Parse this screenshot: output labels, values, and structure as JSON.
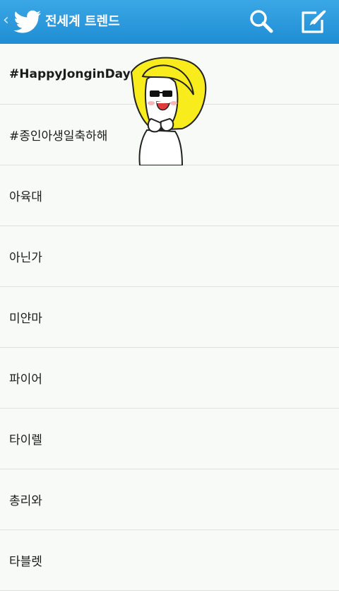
{
  "header": {
    "title": "전세계 트렌드",
    "back_icon": "chevron-left-icon",
    "logo_icon": "twitter-bird-icon",
    "search_icon": "search-icon",
    "compose_icon": "compose-icon",
    "accent_color": "#2b9ae0"
  },
  "trends": [
    {
      "label": "#HappyJonginDay"
    },
    {
      "label": "#종인아생일축하해"
    },
    {
      "label": "아육대"
    },
    {
      "label": "아닌가"
    },
    {
      "label": "미얀마"
    },
    {
      "label": "파이어"
    },
    {
      "label": "타이렐"
    },
    {
      "label": "총리와"
    },
    {
      "label": "타블렛"
    }
  ],
  "sticker": "cartoon-character-sticker"
}
